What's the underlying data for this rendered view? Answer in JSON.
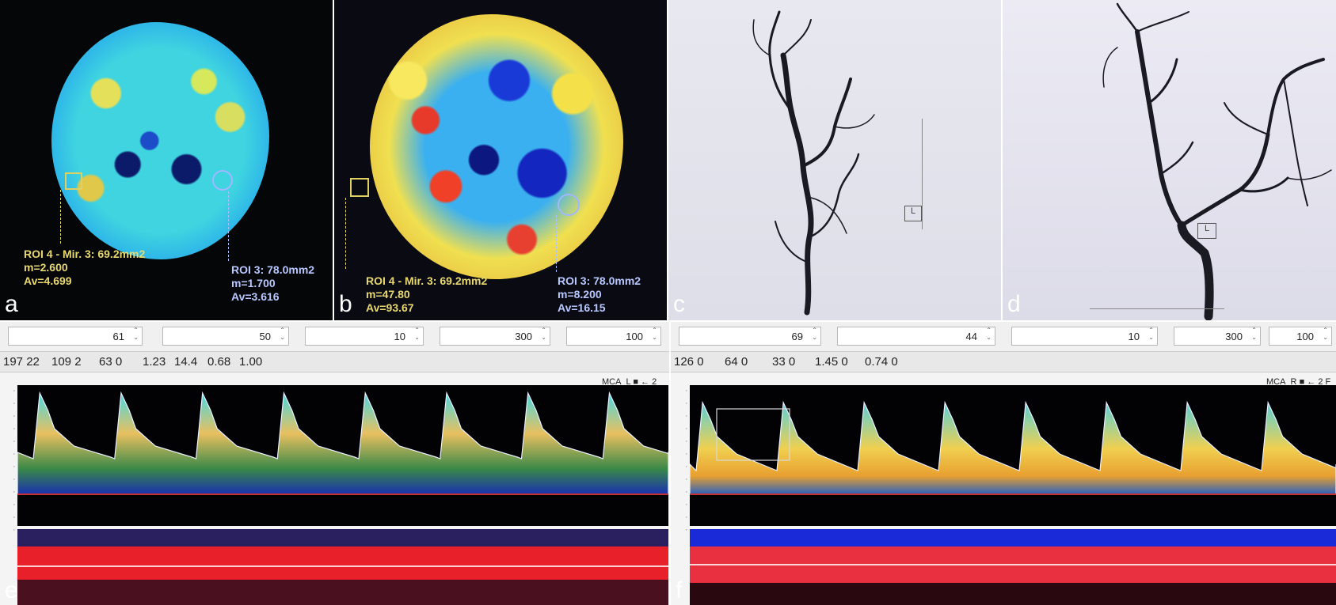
{
  "panels": {
    "a": {
      "letter": "a",
      "roi_left": {
        "line1": "ROI 4 - Mir. 3: 69.2mm2",
        "line2": "m=2.600",
        "line3": "Av=4.699"
      },
      "roi_right": {
        "line1": "ROI 3: 78.0mm2",
        "line2": "m=1.700",
        "line3": "Av=3.616"
      }
    },
    "b": {
      "letter": "b",
      "roi_left": {
        "line1": "ROI 4 - Mir. 3: 69.2mm2",
        "line2": "m=47.80",
        "line3": "Av=93.67"
      },
      "roi_right": {
        "line1": "ROI 3: 78.0mm2",
        "line2": "m=8.200",
        "line3": "Av=16.15"
      }
    },
    "c": {
      "letter": "c",
      "marker": "L"
    },
    "d": {
      "letter": "d",
      "marker": "L"
    },
    "e": {
      "letter": "e",
      "controls": [
        "61",
        "50",
        "10",
        "300",
        "100"
      ],
      "readings": [
        "197 22",
        "109 2",
        "63 0",
        "1.23",
        "14.4",
        "0.68",
        "1.00"
      ],
      "channel": "MCA_L",
      "channel_suffix": "■ ← 2"
    },
    "f": {
      "letter": "f",
      "controls": [
        "69",
        "44",
        "10",
        "300",
        "100"
      ],
      "readings": [
        "126 0",
        "64 0",
        "33 0",
        "1.45 0",
        "0.74 0"
      ],
      "channel": "MCA_R",
      "channel_suffix": "■ ← 2 F"
    }
  },
  "colors": {
    "perfusion_label_yellow": "#e8d870",
    "perfusion_label_blue": "#b8c8ff",
    "doppler_baseline": "#c83030",
    "mmode_red": "#e8202a",
    "mmode_blue": "#1a2ad8"
  }
}
